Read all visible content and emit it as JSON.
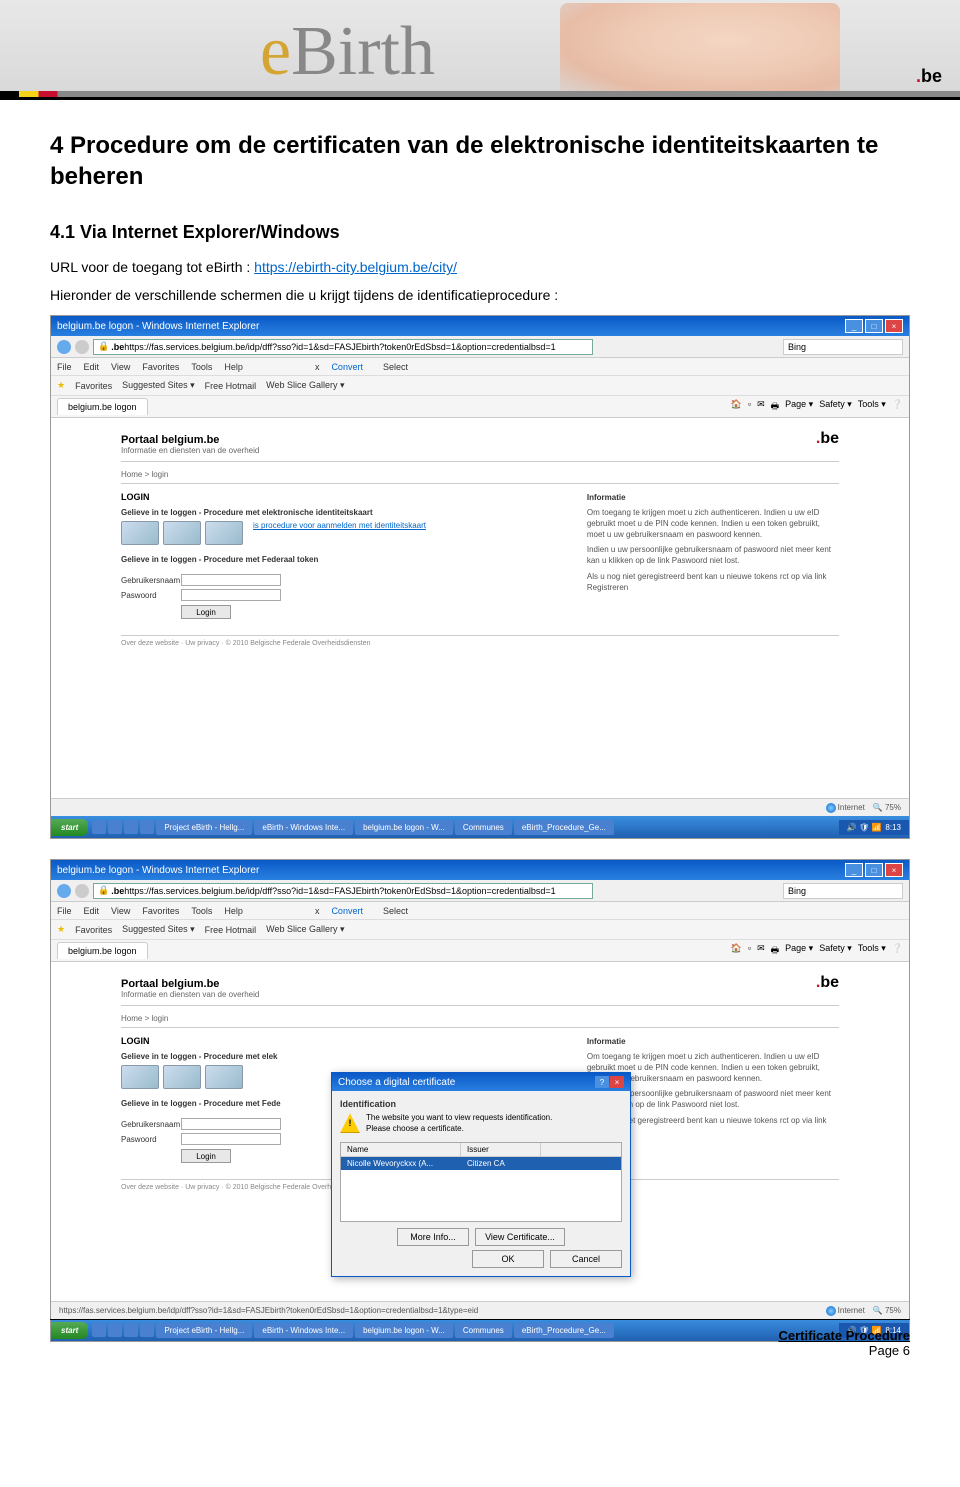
{
  "banner": {
    "logo_e": "e",
    "logo_birth": "Birth",
    "be_dot": ".",
    "be_text": "be"
  },
  "doc": {
    "h1": "4  Procedure om de certificaten van de elektronische identiteitskaarten te beheren",
    "h2": "4.1  Via Internet Explorer/Windows",
    "url_intro": "URL voor de toegang tot eBirth : ",
    "url": "https://ebirth-city.belgium.be/city/",
    "intro2": "Hieronder de verschillende schermen die u krijgt tijdens de identificatieprocedure :"
  },
  "browser": {
    "window_title": "belgium.be logon - Windows Internet Explorer",
    "url": "https://fas.services.belgium.be/idp/dff?sso?id=1&sd=FASJEbirth?token0rEdSbsd=1&option=credentialbsd=1",
    "search_placeholder": "Bing",
    "menu": {
      "file": "File",
      "edit": "Edit",
      "view": "View",
      "favorites": "Favorites",
      "tools": "Tools",
      "help": "Help"
    },
    "convert": "Convert",
    "select": "Select",
    "favorites_label": "Favorites",
    "fav_items": [
      "Suggested Sites ▾",
      "Free Hotmail",
      "Web Slice Gallery ▾"
    ],
    "tab": "belgium.be logon",
    "toolbar_right": [
      "Page ▾",
      "Safety ▾",
      "Tools ▾"
    ],
    "status_url": "https://fas.services.belgium.be/idp/dff?sso?id=1&sd=FASJEbirth?token0rEdSbsd=1&option=credentialbsd=1&type=eid",
    "internet": "Internet",
    "zoom": "75%"
  },
  "portal": {
    "title": "Portaal belgium.be",
    "subtitle": "Informatie en diensten van de overheid",
    "nav": "Home > login",
    "login_head": "LOGIN",
    "login_eid": "Gelieve in te loggen - Procedure met elektronische identiteitskaart",
    "eid_link": "is procedure voor aanmelden met identiteitskaart",
    "login_token": "Gelieve in te loggen - Procedure met Federaal token",
    "user_label": "Gebruikersnaam",
    "pass_label": "Paswoord",
    "login_btn": "Login",
    "info_head": "Informatie",
    "info1": "Om toegang te krijgen moet u zich authenticeren. Indien u uw eID gebruikt moet u de PIN code kennen. Indien u een token gebruikt, moet u uw gebruikersnaam en paswoord kennen.",
    "info2": "Indien u uw persoonlijke gebruikersnaam of paswoord niet meer kent kan u klikken op de link Paswoord niet lost.",
    "info3": "Als u nog niet geregistreerd bent kan u nieuwe tokens rct op via link Registreren",
    "footer": "Over deze website · Uw privacy · © 2010 Belgische Federale Overheidsdiensten"
  },
  "portal2": {
    "login_eid": "Gelieve in te loggen - Procedure met elek",
    "login_token": "Gelieve in te loggen - Procedure met Fede"
  },
  "dialog": {
    "title": "Choose a digital certificate",
    "section": "Identification",
    "msg1": "The website you want to view requests identification.",
    "msg2": "Please choose a certificate.",
    "col_name": "Name",
    "col_issuer": "Issuer",
    "row_name": "Nicolle Wevoryckxx (A...",
    "row_issuer": "Citizen CA",
    "more_info": "More Info...",
    "view_cert": "View Certificate...",
    "ok": "OK",
    "cancel": "Cancel"
  },
  "taskbar": {
    "start": "start",
    "items": [
      "Project eBirth - Hellg...",
      "eBirth - Windows Inte...",
      "belgium.be logon - W...",
      "Communes",
      "eBirth_Procedure_Ge..."
    ],
    "time": "8:13",
    "time2": "8:14"
  },
  "footer": {
    "title": "Certificate Procedure",
    "page": "Page 6"
  }
}
